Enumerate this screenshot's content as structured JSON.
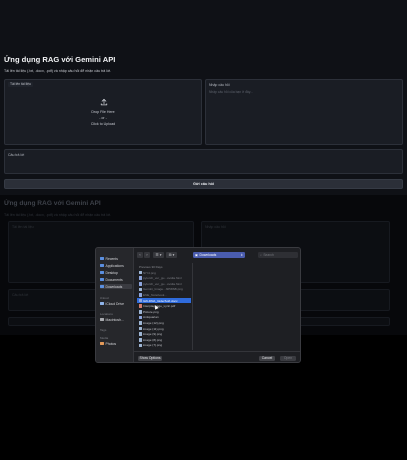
{
  "app": {
    "title": "Ứng dụng RAG với Gemini API",
    "subtitle": "Tải lên tài liệu (.txt, .docx, .pdf) và nhập câu hỏi để nhận câu trả lời.",
    "upload": {
      "chip": "Tải lên tài liệu",
      "drop_line1": "Drop File Here",
      "drop_line2": "- or -",
      "drop_line3": "Click to Upload"
    },
    "question": {
      "label": "Nhập câu hỏi",
      "placeholder": "Nhập câu hỏi của bạn ở đây..."
    },
    "answer": {
      "label": "Câu trả lời"
    },
    "submit_label": "Gửi câu hỏi"
  },
  "ghost": {
    "title": "Ứng dụng RAG với Gemini API",
    "subtitle": "Tải lên tài liệu (.txt, .docx, .pdf) và nhập câu hỏi để nhận câu trả lời.",
    "upload_label": "Tải lên tài liệu",
    "question_label": "Nhập câu hỏi",
    "answer_label": "Câu trả lời"
  },
  "dialog": {
    "sidebar": {
      "favorites": [
        {
          "label": "Recents",
          "icon": "clock-icon"
        },
        {
          "label": "Applications",
          "icon": "applications-icon"
        },
        {
          "label": "Desktop",
          "icon": "desktop-icon"
        },
        {
          "label": "Documents",
          "icon": "document-icon"
        },
        {
          "label": "Downloads",
          "icon": "downloads-icon"
        }
      ],
      "icloud_header": "iCloud",
      "icloud": [
        {
          "label": "iCloud Drive",
          "icon": "cloud-icon"
        }
      ],
      "locations_header": "Locations",
      "locations": [
        {
          "label": "Macintosh...",
          "icon": "disk-icon"
        }
      ],
      "tags_header": "Tags",
      "media_header": "Media",
      "media": [
        {
          "label": "Photos",
          "icon": "photos-icon"
        }
      ]
    },
    "toolbar": {
      "back": "‹",
      "forward": "›",
      "view": "☰ ▾",
      "grid": "⊞ ▾",
      "location": "Downloads",
      "search_placeholder": "Search"
    },
    "column_header": "Previous 30 Days",
    "files": [
      {
        "name": "NIY4.png",
        "type": "img",
        "selected": false
      },
      {
        "name": "pytorch_ver_gu...ovidia.html",
        "type": "doc",
        "selected": false
      },
      {
        "name": "pytorch_ver_gu...ovidia.html",
        "type": "doc",
        "selected": false
      },
      {
        "name": "Gemini_Image...3058SB.png",
        "type": "img",
        "selected": false
      },
      {
        "name": "ENE_Notebook...",
        "type": "doc",
        "selected": false
      },
      {
        "name": "Gift-DNA_GiderSoft.docx",
        "type": "doc",
        "selected": true
      },
      {
        "name": "Interplaguage_Lyric.pdf",
        "type": "pdf",
        "selected": false
      },
      {
        "name": "Picture.png",
        "type": "img",
        "selected": false
      },
      {
        "name": "Antiquarian",
        "type": "doc",
        "selected": false
      },
      {
        "name": "image (12).png",
        "type": "img",
        "selected": false
      },
      {
        "name": "image (11).png",
        "type": "img",
        "selected": false
      },
      {
        "name": "image (9).png",
        "type": "img",
        "selected": false
      },
      {
        "name": "image (8).png",
        "type": "img",
        "selected": false
      },
      {
        "name": "image (7).png",
        "type": "img",
        "selected": false
      }
    ],
    "footer": {
      "options": "Show Options",
      "cancel": "Cancel",
      "open": "Open"
    }
  },
  "colors": {
    "app_bg": "#0f1116",
    "panel_bg": "#1a1d24",
    "selection": "#2f6bdc",
    "location_pill": "#4a5cae"
  }
}
